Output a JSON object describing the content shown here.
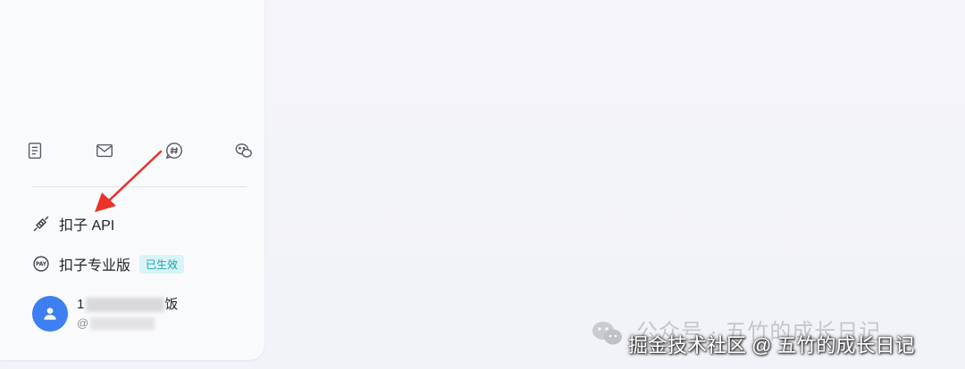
{
  "toolbar_icons": [
    "document-icon",
    "mail-icon",
    "hashtag-chat-icon",
    "wechat-icon"
  ],
  "menu": {
    "api_label": "扣子 API",
    "pro_label": "扣子专业版",
    "pro_badge": "已生效"
  },
  "user": {
    "name_prefix": "1",
    "name_suffix": "饭",
    "handle_prefix": "@"
  },
  "watermark": {
    "line1": "公众号 · 五竹的成长日记",
    "line2": "掘金技术社区 @ 五竹的成长日记"
  },
  "colors": {
    "accent_blue": "#3d7ef2",
    "badge_bg": "#d9f4f6",
    "badge_text": "#19a3ad",
    "arrow_red": "#e8322a"
  }
}
